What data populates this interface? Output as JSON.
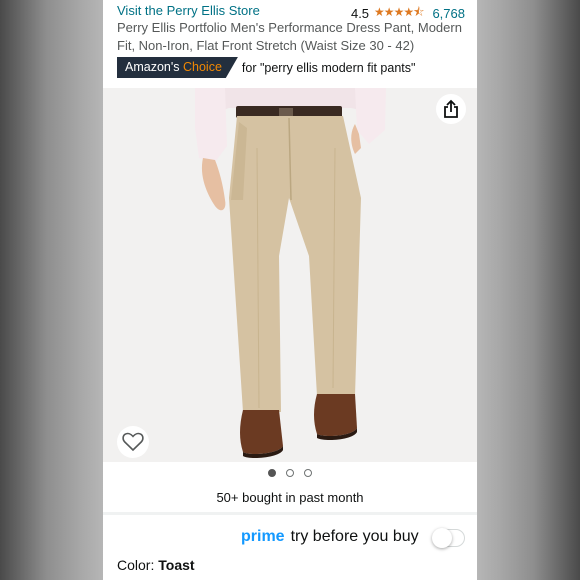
{
  "header": {
    "store_link": "Visit the Perry Ellis Store",
    "rating": "4.5",
    "stars": "★★★★⯪",
    "review_count": "6,768"
  },
  "product": {
    "title": "Perry Ellis Portfolio Men's Performance Dress Pant, Modern Fit, Non-Iron, Flat Front Stretch (Waist Size 30 - 42)",
    "badge_brand": "Amazon's",
    "badge_choice": "Choice",
    "badge_for": "for \"perry ellis modern fit pants\""
  },
  "gallery": {
    "image_count": 3,
    "active_index": 0
  },
  "social_proof": "50+ bought in past month",
  "prime": {
    "logo": "prime",
    "text": "try before you buy",
    "toggle_on": false
  },
  "color": {
    "label": "Color:",
    "value": "Toast"
  },
  "icons": [
    "share-icon",
    "heart-icon",
    "star-icon"
  ],
  "colors": {
    "link": "#007185",
    "star": "#de7921",
    "badge_bg": "#232f3e",
    "badge_accent": "#f08804",
    "prime_blue": "#1399ff"
  }
}
